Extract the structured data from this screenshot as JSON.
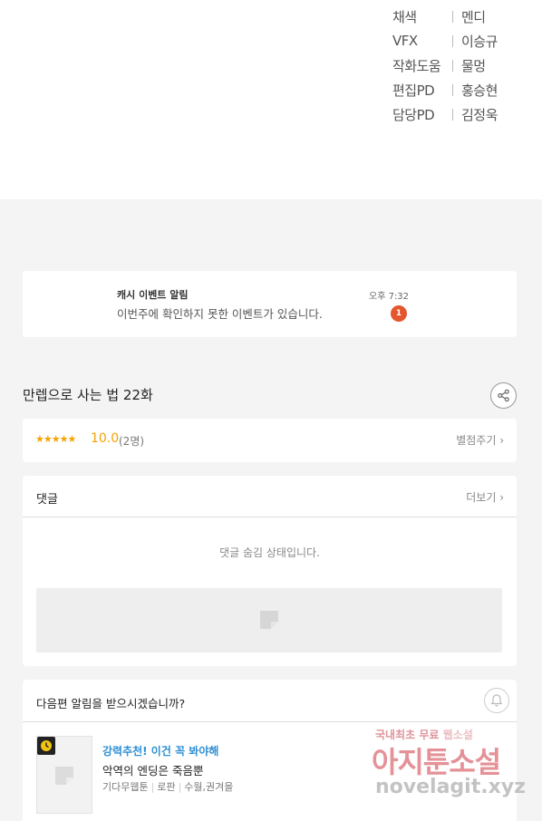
{
  "credits": [
    {
      "role": "채색",
      "name": "멘디"
    },
    {
      "role": "VFX",
      "name": "이승규"
    },
    {
      "role": "작화도움",
      "name": "물멍"
    },
    {
      "role": "편집PD",
      "name": "홍승현"
    },
    {
      "role": "담당PD",
      "name": "김정욱"
    }
  ],
  "notification": {
    "title": "캐시 이벤트 알림",
    "message": "이번주에 확인하지 못한 이벤트가 있습니다.",
    "time": "오후 7:32",
    "badge_count": "1"
  },
  "episode": {
    "title": "만렙으로 사는 법 22화"
  },
  "rating": {
    "stars": "★★★★★",
    "score": "10.0",
    "count": "(2명)",
    "rate_label": "별점주기 ›"
  },
  "comments": {
    "title": "댓글",
    "more_label": "더보기 ›",
    "hidden_message": "댓글 숨김 상태입니다."
  },
  "subscribe": {
    "question": "다음편 알림을 받으시겠습니까?"
  },
  "recommendation": {
    "badge": "강력추천! 이건 꼭 봐야해",
    "title": "악역의 엔딩은 죽음뿐",
    "meta": [
      "기다무웹툰",
      "로판",
      "수월,권겨을"
    ]
  },
  "watermark": {
    "line1_a": "국내최초 무료 ",
    "line1_b": "웹소설",
    "line2": "아지툰소설",
    "line3": "novelagit.xyz"
  },
  "colors": {
    "accent_orange": "#f5a300",
    "badge_red": "#e4572e",
    "link_blue": "#2d8fd5"
  }
}
